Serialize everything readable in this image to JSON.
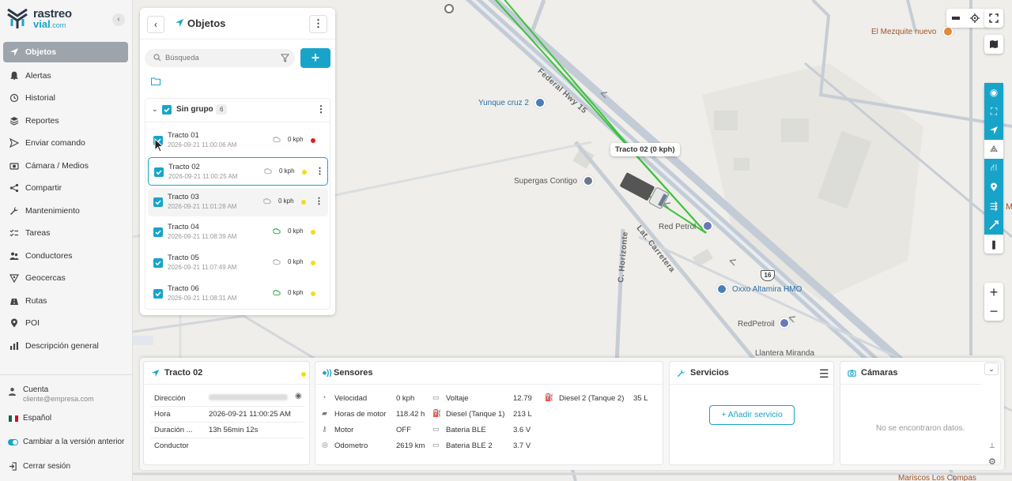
{
  "brand": {
    "name_line1": "rastreo",
    "name_line2": "vial",
    "name_suffix": ".com"
  },
  "sidebar": {
    "items": [
      {
        "label": "Objetos",
        "icon": "navigation-arrow-icon",
        "active": true
      },
      {
        "label": "Alertas",
        "icon": "bell-icon"
      },
      {
        "label": "Historial",
        "icon": "history-icon"
      },
      {
        "label": "Reportes",
        "icon": "layers-icon"
      },
      {
        "label": "Enviar comando",
        "icon": "send-icon"
      },
      {
        "label": "Cámara / Medios",
        "icon": "camera-icon"
      },
      {
        "label": "Compartir",
        "icon": "share-icon"
      },
      {
        "label": "Mantenimiento",
        "icon": "wrench-icon"
      },
      {
        "label": "Tareas",
        "icon": "tasks-icon"
      },
      {
        "label": "Conductores",
        "icon": "drivers-icon"
      },
      {
        "label": "Geocercas",
        "icon": "geofence-icon"
      },
      {
        "label": "Rutas",
        "icon": "route-icon"
      },
      {
        "label": "POI",
        "icon": "pin-icon"
      },
      {
        "label": "Descripción general",
        "icon": "bar-chart-icon"
      }
    ],
    "account_title": "Cuenta",
    "account_email": "cliente@empresa.com",
    "language": "Español",
    "previous_version": "Cambiar a la versión anterior",
    "logout": "Cerrar sesión"
  },
  "objects_panel": {
    "title": "Objetos",
    "search_placeholder": "Búsqueda",
    "group": {
      "name": "Sin grupo",
      "count": "6"
    },
    "rows": [
      {
        "name": "Tracto 01",
        "date": "2026-09-21 11:00:06 AM",
        "speed": "0 kph",
        "status_color": "#e02020",
        "engine_on": false
      },
      {
        "name": "Tracto 02",
        "date": "2026-09-21 11:00:25 AM",
        "speed": "0 kph",
        "status_color": "#f2dc1c",
        "engine_on": false
      },
      {
        "name": "Tracto 03",
        "date": "2026-09-21 11:01:28 AM",
        "speed": "0 kph",
        "status_color": "#f2dc1c",
        "engine_on": false
      },
      {
        "name": "Tracto 04",
        "date": "2026-09-21 11:08:39 AM",
        "speed": "0 kph",
        "status_color": "#f2dc1c",
        "engine_on": true
      },
      {
        "name": "Tracto 05",
        "date": "2026-09-21 11:07:49 AM",
        "speed": "0 kph",
        "status_color": "#f2dc1c",
        "engine_on": false
      },
      {
        "name": "Tracto 06",
        "date": "2026-09-21 11:08:31 AM",
        "speed": "0 kph",
        "status_color": "#f2dc1c",
        "engine_on": true
      }
    ]
  },
  "map": {
    "vehicle_tooltip": "Tracto 02 (0 kph)",
    "labels": {
      "yunque": "Yunque cruz 2",
      "mezquite": "El Mezquite nuevo",
      "supergas": "Supergas Contigo",
      "redpetrol1": "Red Petrol",
      "oxxo": "Oxxo Altamira HMO",
      "redpetrol2": "RedPetroil",
      "llantera": "Llantera Miranda",
      "mariscos": "Mariscos Los Compas",
      "federal_hwy": "Federal Hwy 15",
      "lat_carretera": "Lat. Carretera",
      "c_horizonte": "C. Horizonte",
      "hwy_number": "16",
      "edge_m": "M"
    }
  },
  "bottom": {
    "object": {
      "title": "Tracto 02",
      "status_color": "#f2dc1c",
      "rows": [
        {
          "key": "Dirección",
          "value": ""
        },
        {
          "key": "Hora",
          "value": "2026-09-21 11:00:25 AM"
        },
        {
          "key": "Duración ...",
          "value": "13h 56min 12s"
        },
        {
          "key": "Conductor",
          "value": ""
        }
      ]
    },
    "sensors": {
      "title": "Sensores",
      "col1": [
        {
          "key": "Velocidad",
          "value": "0 kph"
        },
        {
          "key": "Horas de motor",
          "value": "118.42 h"
        },
        {
          "key": "Motor",
          "value": "OFF"
        },
        {
          "key": "Odometro",
          "value": "2619 km"
        }
      ],
      "col2": [
        {
          "key": "Voltaje",
          "value": "12.79"
        },
        {
          "key": "Diesel (Tanque 1)",
          "value": "213 L"
        },
        {
          "key": "Bateria BLE",
          "value": "3.6 V"
        },
        {
          "key": "Bateria BLE 2",
          "value": "3.7 V"
        }
      ],
      "col3": [
        {
          "key": "Diesel 2 (Tanque 2)",
          "value": "35 L"
        }
      ]
    },
    "services": {
      "title": "Servicios",
      "add_label": "+ Añadir servicio"
    },
    "cameras": {
      "title": "Cámaras",
      "empty": "No se encontraron datos."
    }
  }
}
